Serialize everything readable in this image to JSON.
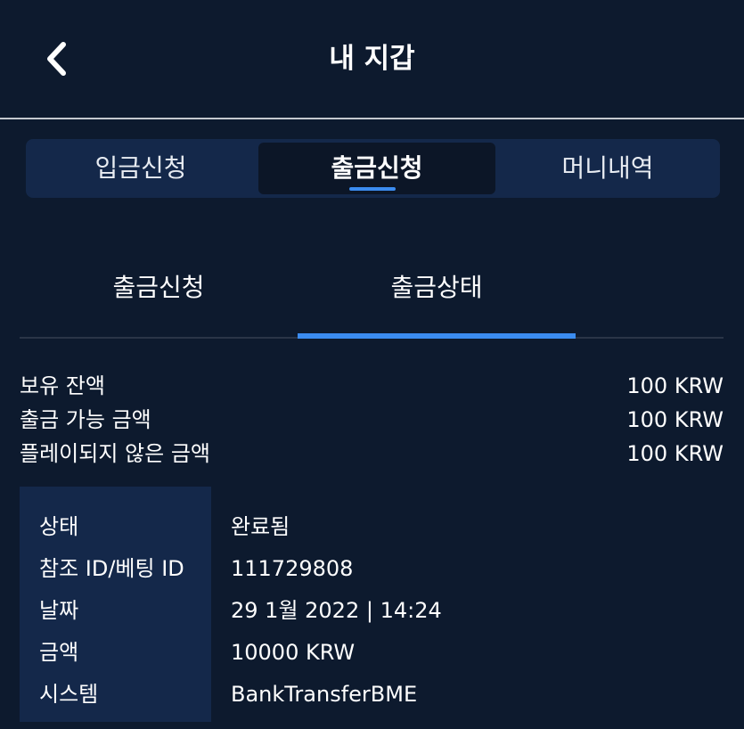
{
  "header": {
    "title": "내 지갑",
    "back_icon": "chevron-left-icon"
  },
  "main_tabs": [
    {
      "label": "입금신청",
      "active": false
    },
    {
      "label": "출금신청",
      "active": true
    },
    {
      "label": "머니내역",
      "active": false
    }
  ],
  "sub_tabs": [
    {
      "label": "출금신청",
      "active": false
    },
    {
      "label": "출금상태",
      "active": true
    }
  ],
  "balances": [
    {
      "label": "보유 잔액",
      "value": "100 KRW"
    },
    {
      "label": "출금 가능 금액",
      "value": "100 KRW"
    },
    {
      "label": "플레이되지 않은 금액",
      "value": "100 KRW"
    }
  ],
  "details": [
    {
      "label": "상태",
      "value": "완료됨"
    },
    {
      "label": "참조 ID/베팅 ID",
      "value": "111729808"
    },
    {
      "label": "날짜",
      "value": "29 1월 2022 | 14:24"
    },
    {
      "label": "금액",
      "value": "10000 KRW"
    },
    {
      "label": "시스템",
      "value": "BankTransferBME"
    }
  ],
  "colors": {
    "background": "#0d1a2e",
    "panel": "#14284a",
    "accent": "#3b8cf0"
  }
}
